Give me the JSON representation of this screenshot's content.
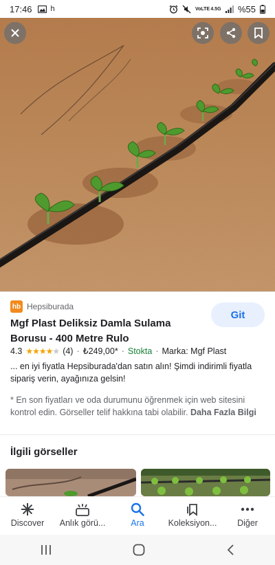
{
  "status_bar": {
    "time": "17:46",
    "carrier_glyph": "h",
    "volte_label": "VoLTE",
    "network": "4.5G",
    "battery": "%55"
  },
  "image_overlay": {
    "close": "close-icon",
    "lens": "lens-icon",
    "share": "share-icon",
    "bookmark": "bookmark-icon"
  },
  "result": {
    "source_logo": "hb",
    "source_name": "Hepsiburada",
    "visit_label": "Git",
    "title": "Mgf Plast Deliksiz Damla Sulama Borusu - 400 Metre Rulo",
    "rating": "4.3",
    "rating_value": 4.3,
    "review_count": "(4)",
    "price": "₺249,00*",
    "stock": "Stokta",
    "brand": "Marka: Mgf Plast",
    "description": "... en iyi fiyatla Hepsiburada'dan satın alın! Şimdi indirimli fiyatla sipariş verin, ayağınıza gelsin!",
    "note": "* En son fiyatları ve oda durumunu öğrenmek için web sitesini kontrol edin. Görseller telif hakkına tabi olabilir.",
    "more_link": "Daha Fazla Bilgi"
  },
  "related_heading": "İlgili görseller",
  "bottom_nav": [
    {
      "label": "Discover",
      "icon": "asterisk-icon",
      "active": false
    },
    {
      "label": "Anlık görü...",
      "icon": "updates-icon",
      "active": false
    },
    {
      "label": "Ara",
      "icon": "search-icon",
      "active": true
    },
    {
      "label": "Koleksiyon...",
      "icon": "collections-icon",
      "active": false
    },
    {
      "label": "Diğer",
      "icon": "more-icon",
      "active": false
    }
  ],
  "colors": {
    "accent": "#1a73e8",
    "stock_green": "#188038",
    "star": "#f4a400",
    "brand_orange": "#f28b1e"
  }
}
